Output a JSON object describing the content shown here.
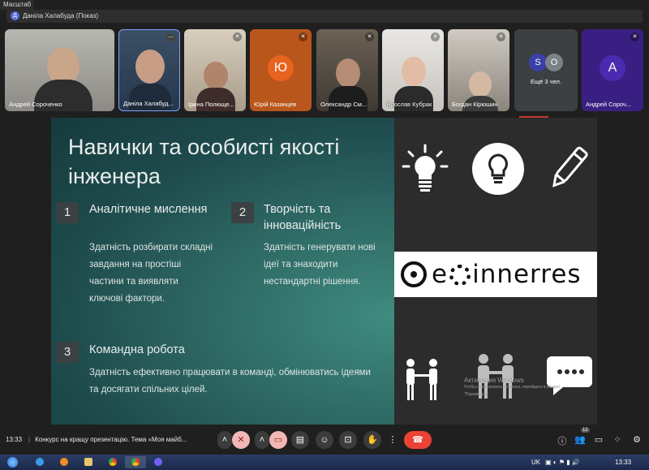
{
  "top": {
    "scale_label": "Масштаб",
    "presenter_avatar": "Д",
    "presenter": "Даніла Халабуда (Показ)"
  },
  "participants": [
    {
      "name": "Андрей Сороченко",
      "avatar": ""
    },
    {
      "name": "Даніла Халабуд...",
      "avatar": ""
    },
    {
      "name": "Ірина Полюще...",
      "avatar": ""
    },
    {
      "name": "Юрій Казанцев",
      "avatar": "Ю",
      "color": "#e8631e"
    },
    {
      "name": "Олександр См...",
      "avatar": ""
    },
    {
      "name": "Ярослав Кубрак",
      "avatar": ""
    },
    {
      "name": "Богдан Кірюшин",
      "avatar": ""
    },
    {
      "name": "Ещё 3 чел.",
      "avatar": ""
    },
    {
      "name": "Андрей Сороч...",
      "avatar": "А",
      "color": "#4a2bb0"
    }
  ],
  "more_avatars": [
    "S",
    "O"
  ],
  "more_colors": [
    "#3b3fa8",
    "#7c8287"
  ],
  "slide": {
    "title_line1": "Навички та особисті якості",
    "title_line2": "інженера",
    "items": [
      {
        "num": "1",
        "title": "Аналітичне мислення",
        "body_lines": [
          "Здатність розбирати складні",
          "завдання на простіші",
          "частини та виявляти",
          "ключові фактори."
        ]
      },
      {
        "num": "2",
        "title_lines": [
          "Творчість та",
          "інноваційність"
        ],
        "body_lines": [
          "Здатність генерувати нові",
          "ідеї та знаходити",
          "нестандартні рішення."
        ]
      },
      {
        "num": "3",
        "title": "Командна робота",
        "body_lines": [
          "Здатність ефективно працювати в команді, обмінюватись ідеями",
          "та досягати спільних цілей."
        ]
      }
    ],
    "logo_text": "e",
    "logo_text_rest": "innerres",
    "watermark_line1": "Активация Windows",
    "watermark_line2": "Чтобы активировать Windows, перейдите в раздел",
    "watermark_line3": "\"Параметры\"."
  },
  "bottom": {
    "time": "13:33",
    "meeting": "Конкурс на кращу презентацію. Тема «Моя майб...",
    "participant_count": "12"
  },
  "taskbar": {
    "lang": "UK",
    "time": "13:33"
  },
  "colors": {
    "accent_red": "#ea4335",
    "muted_pink": "#f2b8b5"
  }
}
